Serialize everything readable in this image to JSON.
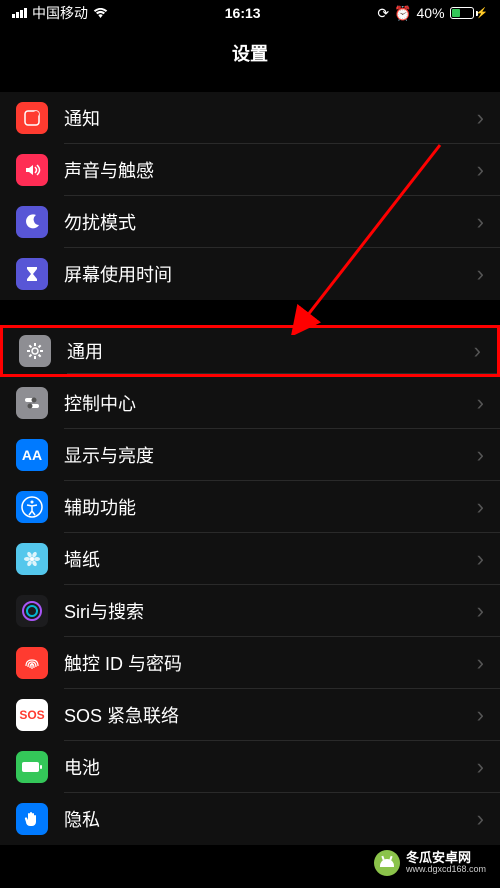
{
  "status": {
    "carrier": "中国移动",
    "time": "16:13",
    "battery_pct": "40%"
  },
  "header": {
    "title": "设置"
  },
  "groups": [
    {
      "items": [
        {
          "key": "notifications",
          "label": "通知",
          "bg": "#ff3b30",
          "icon": "notify"
        },
        {
          "key": "sounds",
          "label": "声音与触感",
          "bg": "#ff2d55",
          "icon": "sound"
        },
        {
          "key": "dnd",
          "label": "勿扰模式",
          "bg": "#5856d6",
          "icon": "moon"
        },
        {
          "key": "screentime",
          "label": "屏幕使用时间",
          "bg": "#5856d6",
          "icon": "hourglass"
        }
      ]
    },
    {
      "items": [
        {
          "key": "general",
          "label": "通用",
          "bg": "#8e8e93",
          "icon": "gear",
          "highlighted": true
        },
        {
          "key": "controlcenter",
          "label": "控制中心",
          "bg": "#8e8e93",
          "icon": "switches"
        },
        {
          "key": "display",
          "label": "显示与亮度",
          "bg": "#007aff",
          "icon": "AA"
        },
        {
          "key": "accessibility",
          "label": "辅助功能",
          "bg": "#007aff",
          "icon": "access"
        },
        {
          "key": "wallpaper",
          "label": "墙纸",
          "bg": "#54c7ec",
          "icon": "flower"
        },
        {
          "key": "siri",
          "label": "Siri与搜索",
          "bg": "#1c1c1e",
          "icon": "siri"
        },
        {
          "key": "touchid",
          "label": "触控 ID 与密码",
          "bg": "#ff3b30",
          "icon": "fingerprint"
        },
        {
          "key": "sos",
          "label": "SOS 紧急联络",
          "bg": "#ffffff",
          "icon": "SOS",
          "fg": "#ff3b30"
        },
        {
          "key": "battery",
          "label": "电池",
          "bg": "#34c759",
          "icon": "battery"
        },
        {
          "key": "privacy",
          "label": "隐私",
          "bg": "#007aff",
          "icon": "hand"
        }
      ]
    }
  ],
  "watermark": {
    "name": "冬瓜安卓网",
    "url": "www.dgxcd168.com"
  }
}
